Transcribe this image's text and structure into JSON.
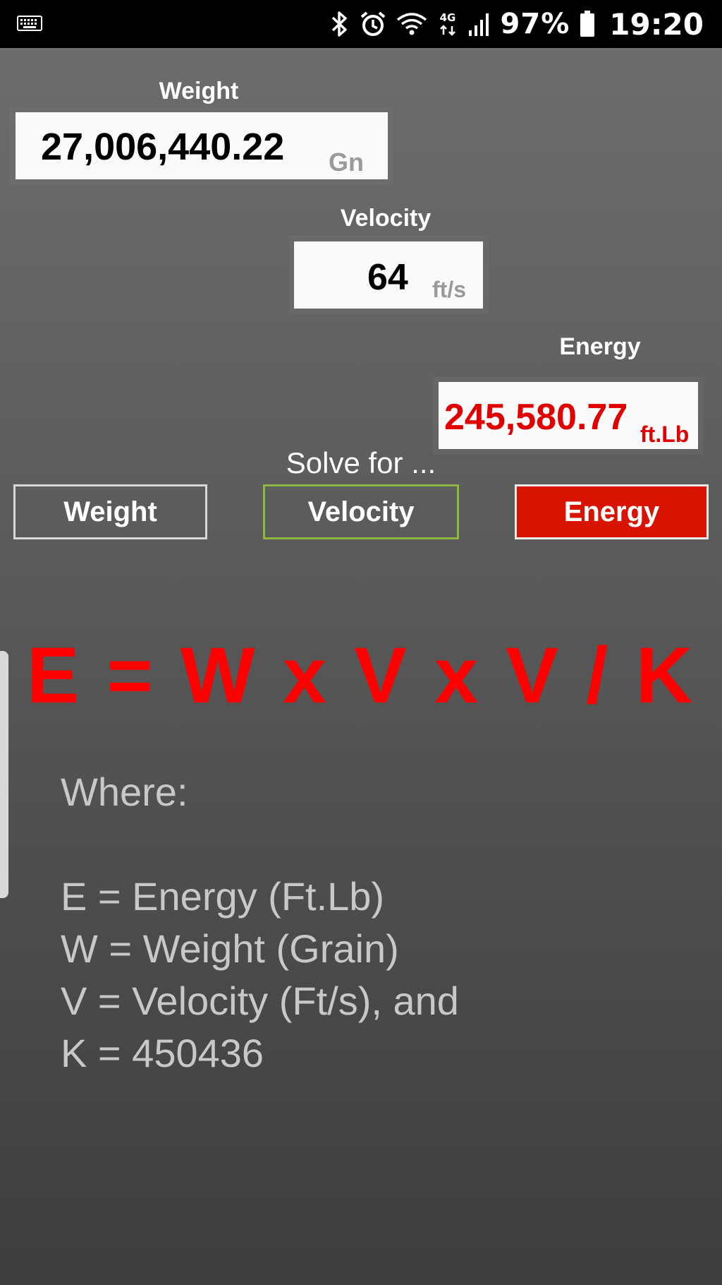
{
  "status_bar": {
    "left_icon": "keyboard-icon",
    "icons": [
      "bluetooth-icon",
      "alarm-icon",
      "wifi-icon",
      "4g-icon",
      "signal-icon",
      "battery-icon"
    ],
    "network": "4G",
    "battery": "97%",
    "time": "19:20"
  },
  "weight": {
    "label": "Weight",
    "value": "27,006,440.22",
    "unit": "Gn"
  },
  "velocity": {
    "label": "Velocity",
    "value": "64",
    "unit": "ft/s"
  },
  "energy": {
    "label": "Energy",
    "value": "245,580.77",
    "unit": "ft.Lb"
  },
  "solve": {
    "label": "Solve for ...",
    "buttons": [
      {
        "label": "Weight",
        "state": "normal"
      },
      {
        "label": "Velocity",
        "state": "selected"
      },
      {
        "label": "Energy",
        "state": "active"
      }
    ]
  },
  "formula": "E = W x V x V / K",
  "legend": {
    "heading": "Where:",
    "lines": [
      "E = Energy (Ft.Lb)",
      "W = Weight (Grain)",
      "V = Velocity (Ft/s), and",
      "K = 450436"
    ]
  },
  "colors": {
    "accent_red": "#ff0000",
    "button_active": "#d81400",
    "button_selected_border": "#8fb640"
  }
}
